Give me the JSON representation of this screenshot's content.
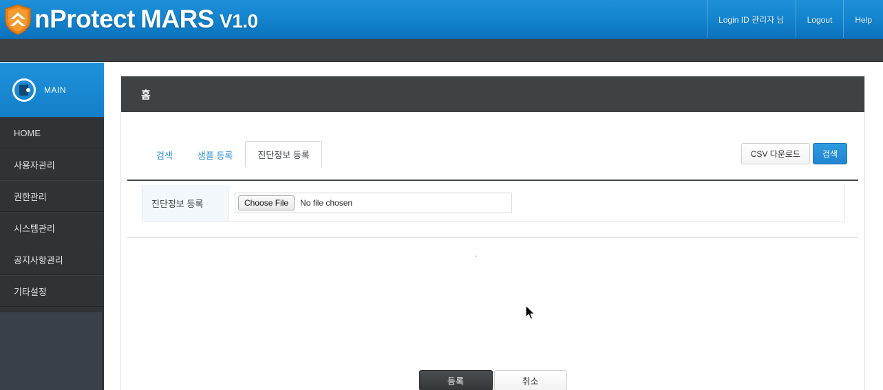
{
  "header": {
    "logo_icon": "shield-icon",
    "brand_name": "nProtect",
    "product": "MARS",
    "version": "V1.0",
    "links": [
      {
        "label": "Login ID 관리자 님",
        "name": "login-id"
      },
      {
        "label": "Logout",
        "name": "logout"
      },
      {
        "label": "Help",
        "name": "help"
      }
    ]
  },
  "sidebar": {
    "main": {
      "icon": "main-circle-icon",
      "label": "MAIN"
    },
    "items": [
      {
        "label": "HOME"
      },
      {
        "label": "사용자관리"
      },
      {
        "label": "권한관리"
      },
      {
        "label": "시스템관리"
      },
      {
        "label": "공지사항관리"
      },
      {
        "label": "기타설정"
      }
    ]
  },
  "panel": {
    "title": "홈",
    "tabs": [
      {
        "label": "검색",
        "active": false
      },
      {
        "label": "샘플 등록",
        "active": false
      },
      {
        "label": "진단정보 등록",
        "active": true
      }
    ],
    "actions": {
      "csv_label": "CSV 다운로드",
      "search_label": "검색"
    },
    "form": {
      "row_label": "진단정보 등록",
      "file_button_label": "Choose File",
      "file_status": "No file chosen"
    },
    "placeholder_text": ".",
    "footer": {
      "submit_label": "등록",
      "cancel_label": "취소"
    }
  },
  "colors": {
    "header_blue": "#1485cf",
    "accent_blue": "#2f8fd6",
    "dark_panel": "#3e4245",
    "sidebar_dark": "#2f3336",
    "sidebar_filler": "#3a4148"
  }
}
